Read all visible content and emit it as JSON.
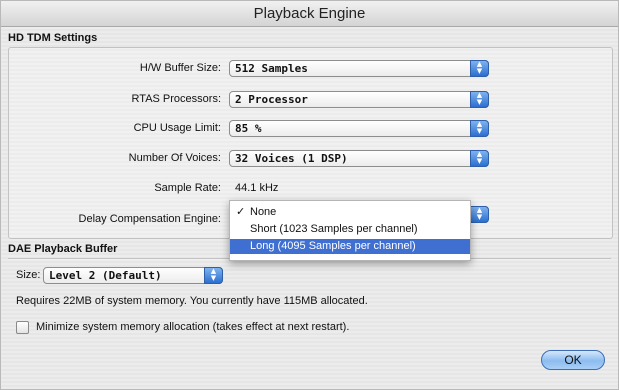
{
  "window": {
    "title": "Playback Engine"
  },
  "hd_tdm": {
    "section_label": "HD TDM Settings",
    "rows": [
      {
        "label": "H/W Buffer Size:",
        "value": "512 Samples"
      },
      {
        "label": "RTAS Processors:",
        "value": "2 Processor"
      },
      {
        "label": "CPU Usage Limit:",
        "value": "85 %"
      },
      {
        "label": "Number Of Voices:",
        "value": "32 Voices (1 DSP)"
      }
    ],
    "sample_rate": {
      "label": "Sample Rate:",
      "value": "44.1 kHz"
    },
    "delay_comp": {
      "label": "Delay Compensation Engine:",
      "menu_items": [
        {
          "label": "None",
          "checked": true,
          "selected": false
        },
        {
          "label": "Short (1023 Samples per channel)",
          "checked": false,
          "selected": false
        },
        {
          "label": "Long (4095 Samples per channel)",
          "checked": false,
          "selected": true
        }
      ],
      "check_glyph": "✓"
    }
  },
  "dae": {
    "section_label": "DAE Playback Buffer",
    "size_label": "Size:",
    "size_value": "Level 2 (Default)",
    "memory_text": "Requires 22MB of system memory. You currently have 115MB allocated.",
    "minimize_label": "Minimize system memory allocation (takes effect at next restart).",
    "minimize_checked": false
  },
  "buttons": {
    "ok_label": "OK"
  },
  "icons": {
    "popup_arrows": "updown-arrows-icon"
  },
  "colors": {
    "accent": "#3f6fd1",
    "popup_arrow": "#2c6fd0"
  }
}
